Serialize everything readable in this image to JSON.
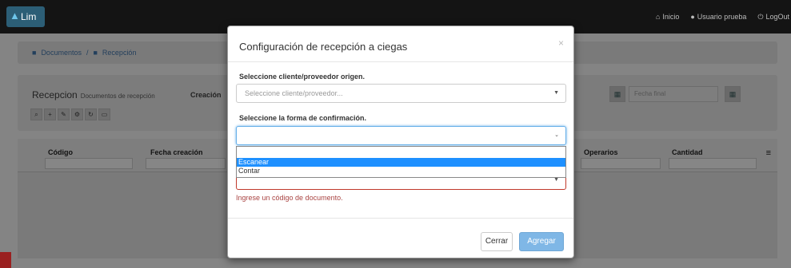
{
  "navbar": {
    "brand": "Lim",
    "links": [
      {
        "icon": "home-icon",
        "label": "Inicio"
      },
      {
        "icon": "user-icon",
        "label": "Usuario prueba"
      },
      {
        "icon": "power-icon",
        "label": "LogOut"
      }
    ]
  },
  "breadcrumb": {
    "items": [
      "Documentos",
      "Recepción"
    ]
  },
  "panel": {
    "title": "Recepcion",
    "subtitle": "Documentos de recepción",
    "creacion_label": "Creación",
    "date_to_placeholder": "Fecha final"
  },
  "grid": {
    "columns": [
      "Código",
      "Fecha creación",
      "Operarios",
      "Cantidad"
    ]
  },
  "modal": {
    "title": "Configuración de recepción a ciegas",
    "close": "×",
    "origin_label": "Seleccione cliente/proveedor origen.",
    "origin_placeholder": "Seleccione cliente/proveedor...",
    "confirm_label": "Seleccione la forma de confirmación.",
    "confirm_value": "",
    "options": [
      "Escanear",
      "Contar"
    ],
    "selected_option": "Escanear",
    "error_text": "Ingrese un código de documento.",
    "cancel_label": "Cerrar",
    "submit_label": "Agregar"
  },
  "colors": {
    "primary": "#7fb7e6",
    "selection": "#1e90ff",
    "error": "#a94442"
  }
}
